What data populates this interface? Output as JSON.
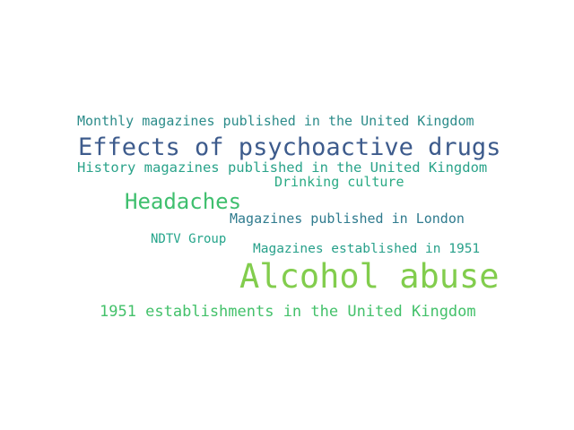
{
  "words": [
    {
      "text": "Monthly magazines published in the United Kingdom",
      "color": "#2c8c8a"
    },
    {
      "text": "Effects of psychoactive drugs",
      "color": "#3d5b8c"
    },
    {
      "text": "History magazines published in the United Kingdom",
      "color": "#2aa38a"
    },
    {
      "text": "Drinking culture",
      "color": "#2aaa84"
    },
    {
      "text": "Headaches",
      "color": "#3fbf6e"
    },
    {
      "text": "Magazines published in London",
      "color": "#2f7b8e"
    },
    {
      "text": "NDTV Group",
      "color": "#25a58b"
    },
    {
      "text": "Magazines established in 1951",
      "color": "#27a08a"
    },
    {
      "text": "Alcohol abuse",
      "color": "#82cd4d"
    },
    {
      "text": "1951 establishments in the United Kingdom",
      "color": "#43c16a"
    }
  ]
}
